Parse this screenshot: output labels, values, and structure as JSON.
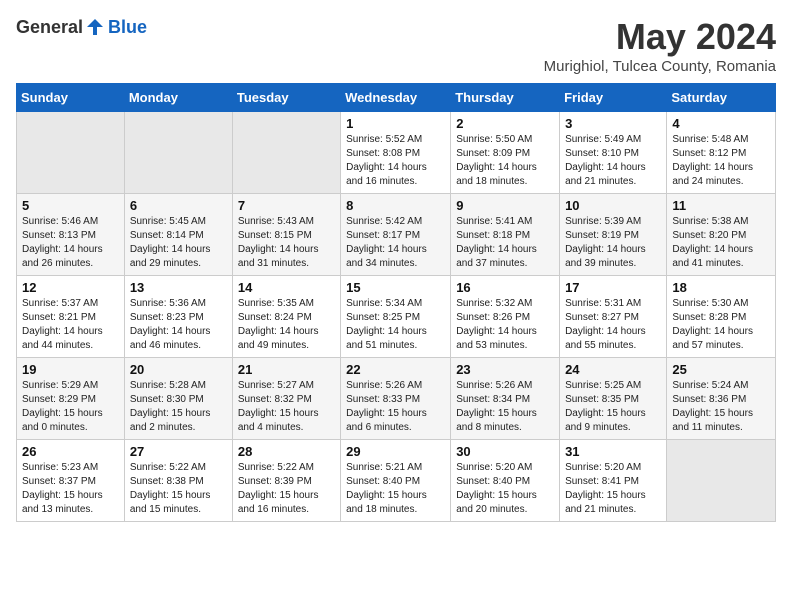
{
  "logo": {
    "general": "General",
    "blue": "Blue"
  },
  "header": {
    "month": "May 2024",
    "location": "Murighiol, Tulcea County, Romania"
  },
  "weekdays": [
    "Sunday",
    "Monday",
    "Tuesday",
    "Wednesday",
    "Thursday",
    "Friday",
    "Saturday"
  ],
  "weeks": [
    [
      {
        "day": "",
        "sunrise": "",
        "sunset": "",
        "daylight": ""
      },
      {
        "day": "",
        "sunrise": "",
        "sunset": "",
        "daylight": ""
      },
      {
        "day": "",
        "sunrise": "",
        "sunset": "",
        "daylight": ""
      },
      {
        "day": "1",
        "sunrise": "Sunrise: 5:52 AM",
        "sunset": "Sunset: 8:08 PM",
        "daylight": "Daylight: 14 hours and 16 minutes."
      },
      {
        "day": "2",
        "sunrise": "Sunrise: 5:50 AM",
        "sunset": "Sunset: 8:09 PM",
        "daylight": "Daylight: 14 hours and 18 minutes."
      },
      {
        "day": "3",
        "sunrise": "Sunrise: 5:49 AM",
        "sunset": "Sunset: 8:10 PM",
        "daylight": "Daylight: 14 hours and 21 minutes."
      },
      {
        "day": "4",
        "sunrise": "Sunrise: 5:48 AM",
        "sunset": "Sunset: 8:12 PM",
        "daylight": "Daylight: 14 hours and 24 minutes."
      }
    ],
    [
      {
        "day": "5",
        "sunrise": "Sunrise: 5:46 AM",
        "sunset": "Sunset: 8:13 PM",
        "daylight": "Daylight: 14 hours and 26 minutes."
      },
      {
        "day": "6",
        "sunrise": "Sunrise: 5:45 AM",
        "sunset": "Sunset: 8:14 PM",
        "daylight": "Daylight: 14 hours and 29 minutes."
      },
      {
        "day": "7",
        "sunrise": "Sunrise: 5:43 AM",
        "sunset": "Sunset: 8:15 PM",
        "daylight": "Daylight: 14 hours and 31 minutes."
      },
      {
        "day": "8",
        "sunrise": "Sunrise: 5:42 AM",
        "sunset": "Sunset: 8:17 PM",
        "daylight": "Daylight: 14 hours and 34 minutes."
      },
      {
        "day": "9",
        "sunrise": "Sunrise: 5:41 AM",
        "sunset": "Sunset: 8:18 PM",
        "daylight": "Daylight: 14 hours and 37 minutes."
      },
      {
        "day": "10",
        "sunrise": "Sunrise: 5:39 AM",
        "sunset": "Sunset: 8:19 PM",
        "daylight": "Daylight: 14 hours and 39 minutes."
      },
      {
        "day": "11",
        "sunrise": "Sunrise: 5:38 AM",
        "sunset": "Sunset: 8:20 PM",
        "daylight": "Daylight: 14 hours and 41 minutes."
      }
    ],
    [
      {
        "day": "12",
        "sunrise": "Sunrise: 5:37 AM",
        "sunset": "Sunset: 8:21 PM",
        "daylight": "Daylight: 14 hours and 44 minutes."
      },
      {
        "day": "13",
        "sunrise": "Sunrise: 5:36 AM",
        "sunset": "Sunset: 8:23 PM",
        "daylight": "Daylight: 14 hours and 46 minutes."
      },
      {
        "day": "14",
        "sunrise": "Sunrise: 5:35 AM",
        "sunset": "Sunset: 8:24 PM",
        "daylight": "Daylight: 14 hours and 49 minutes."
      },
      {
        "day": "15",
        "sunrise": "Sunrise: 5:34 AM",
        "sunset": "Sunset: 8:25 PM",
        "daylight": "Daylight: 14 hours and 51 minutes."
      },
      {
        "day": "16",
        "sunrise": "Sunrise: 5:32 AM",
        "sunset": "Sunset: 8:26 PM",
        "daylight": "Daylight: 14 hours and 53 minutes."
      },
      {
        "day": "17",
        "sunrise": "Sunrise: 5:31 AM",
        "sunset": "Sunset: 8:27 PM",
        "daylight": "Daylight: 14 hours and 55 minutes."
      },
      {
        "day": "18",
        "sunrise": "Sunrise: 5:30 AM",
        "sunset": "Sunset: 8:28 PM",
        "daylight": "Daylight: 14 hours and 57 minutes."
      }
    ],
    [
      {
        "day": "19",
        "sunrise": "Sunrise: 5:29 AM",
        "sunset": "Sunset: 8:29 PM",
        "daylight": "Daylight: 15 hours and 0 minutes."
      },
      {
        "day": "20",
        "sunrise": "Sunrise: 5:28 AM",
        "sunset": "Sunset: 8:30 PM",
        "daylight": "Daylight: 15 hours and 2 minutes."
      },
      {
        "day": "21",
        "sunrise": "Sunrise: 5:27 AM",
        "sunset": "Sunset: 8:32 PM",
        "daylight": "Daylight: 15 hours and 4 minutes."
      },
      {
        "day": "22",
        "sunrise": "Sunrise: 5:26 AM",
        "sunset": "Sunset: 8:33 PM",
        "daylight": "Daylight: 15 hours and 6 minutes."
      },
      {
        "day": "23",
        "sunrise": "Sunrise: 5:26 AM",
        "sunset": "Sunset: 8:34 PM",
        "daylight": "Daylight: 15 hours and 8 minutes."
      },
      {
        "day": "24",
        "sunrise": "Sunrise: 5:25 AM",
        "sunset": "Sunset: 8:35 PM",
        "daylight": "Daylight: 15 hours and 9 minutes."
      },
      {
        "day": "25",
        "sunrise": "Sunrise: 5:24 AM",
        "sunset": "Sunset: 8:36 PM",
        "daylight": "Daylight: 15 hours and 11 minutes."
      }
    ],
    [
      {
        "day": "26",
        "sunrise": "Sunrise: 5:23 AM",
        "sunset": "Sunset: 8:37 PM",
        "daylight": "Daylight: 15 hours and 13 minutes."
      },
      {
        "day": "27",
        "sunrise": "Sunrise: 5:22 AM",
        "sunset": "Sunset: 8:38 PM",
        "daylight": "Daylight: 15 hours and 15 minutes."
      },
      {
        "day": "28",
        "sunrise": "Sunrise: 5:22 AM",
        "sunset": "Sunset: 8:39 PM",
        "daylight": "Daylight: 15 hours and 16 minutes."
      },
      {
        "day": "29",
        "sunrise": "Sunrise: 5:21 AM",
        "sunset": "Sunset: 8:40 PM",
        "daylight": "Daylight: 15 hours and 18 minutes."
      },
      {
        "day": "30",
        "sunrise": "Sunrise: 5:20 AM",
        "sunset": "Sunset: 8:40 PM",
        "daylight": "Daylight: 15 hours and 20 minutes."
      },
      {
        "day": "31",
        "sunrise": "Sunrise: 5:20 AM",
        "sunset": "Sunset: 8:41 PM",
        "daylight": "Daylight: 15 hours and 21 minutes."
      },
      {
        "day": "",
        "sunrise": "",
        "sunset": "",
        "daylight": ""
      }
    ]
  ]
}
